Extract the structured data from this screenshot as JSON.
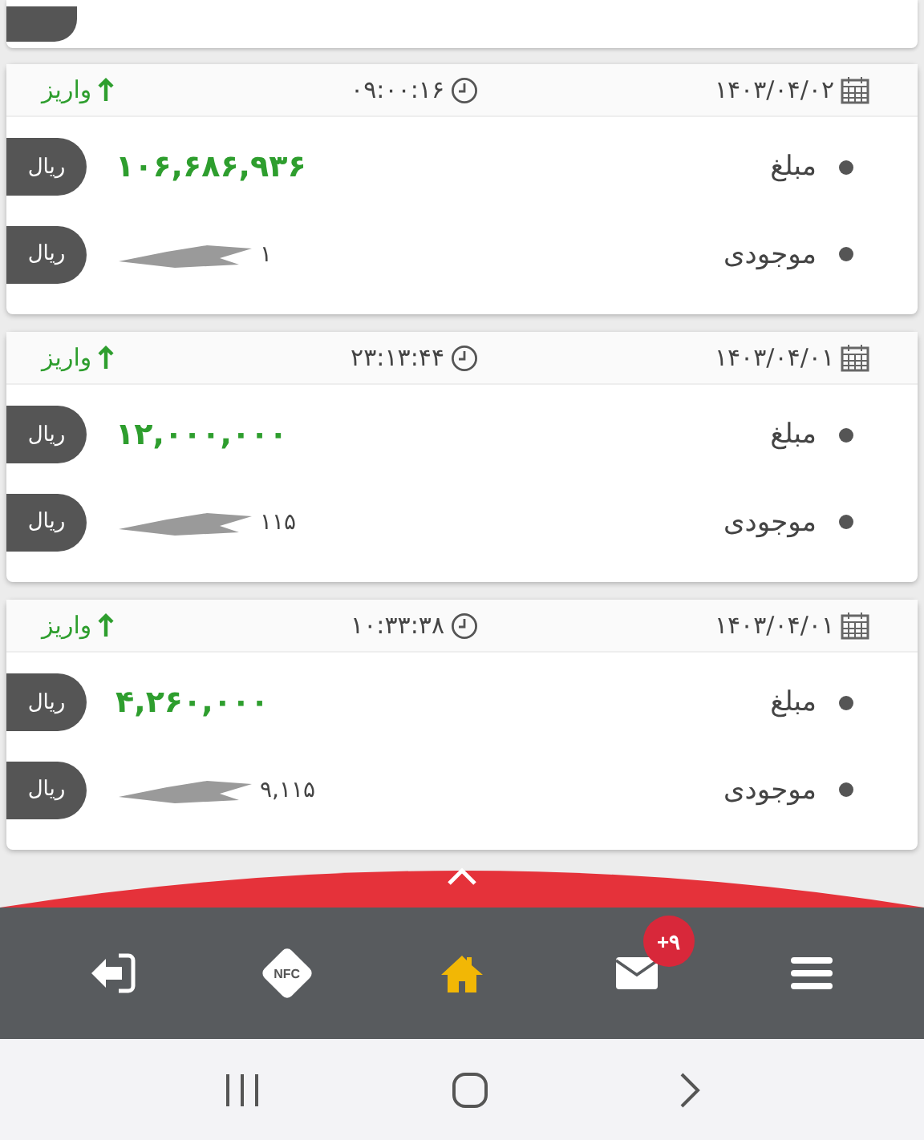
{
  "transactions": [
    {
      "date": "۱۴۰۳/۰۴/۰۲",
      "time": "۰۹:۰۰:۱۶",
      "type": "واریز",
      "amount_label": "مبلغ",
      "amount": "۱۰۶,۶۸۶,۹۳۶",
      "amount_currency": "ریال",
      "balance_label": "موجودی",
      "balance": "۱",
      "balance_currency": "ریال"
    },
    {
      "date": "۱۴۰۳/۰۴/۰۱",
      "time": "۲۳:۱۳:۴۴",
      "type": "واریز",
      "amount_label": "مبلغ",
      "amount": "۱۲,۰۰۰,۰۰۰",
      "amount_currency": "ریال",
      "balance_label": "موجودی",
      "balance": "۱۱۵",
      "balance_currency": "ریال"
    },
    {
      "date": "۱۴۰۳/۰۴/۰۱",
      "time": "۱۰:۳۳:۳۸",
      "type": "واریز",
      "amount_label": "مبلغ",
      "amount": "۴,۲۶۰,۰۰۰",
      "amount_currency": "ریال",
      "balance_label": "موجودی",
      "balance": "۹,۱۱۵",
      "balance_currency": "ریال"
    }
  ],
  "bottom_nav": [
    {
      "kind": "logout",
      "selected": false
    },
    {
      "kind": "nfc",
      "label": "NFC",
      "selected": false
    },
    {
      "kind": "home",
      "selected": true
    },
    {
      "kind": "mail",
      "badge": "+۹",
      "selected": false
    },
    {
      "kind": "menu",
      "selected": false
    }
  ]
}
